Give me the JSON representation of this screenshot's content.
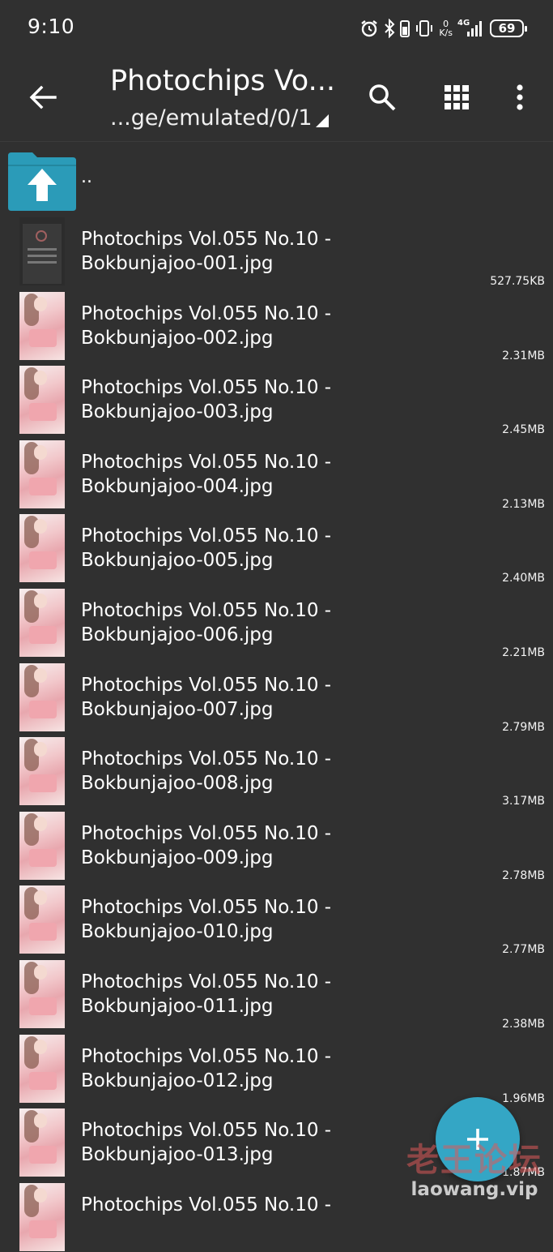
{
  "status_bar": {
    "time": "9:10",
    "net_speed_value": "0",
    "net_speed_unit": "K/s",
    "network": "4G",
    "battery": "69"
  },
  "app_bar": {
    "title": "Photochips Vo...",
    "path": "...ge/emulated/0/1",
    "icons": [
      "back-arrow-icon",
      "search-icon",
      "grid-view-icon",
      "more-vert-icon"
    ]
  },
  "up_entry": {
    "label": ".."
  },
  "files": [
    {
      "line1": "Photochips Vol.055 No.10 -",
      "line2": "Bokbunjajoo-001.jpg",
      "size": "527.75KB"
    },
    {
      "line1": "Photochips Vol.055 No.10 -",
      "line2": "Bokbunjajoo-002.jpg",
      "size": "2.31MB"
    },
    {
      "line1": "Photochips Vol.055 No.10 -",
      "line2": "Bokbunjajoo-003.jpg",
      "size": "2.45MB"
    },
    {
      "line1": "Photochips Vol.055 No.10 -",
      "line2": "Bokbunjajoo-004.jpg",
      "size": "2.13MB"
    },
    {
      "line1": "Photochips Vol.055 No.10 -",
      "line2": "Bokbunjajoo-005.jpg",
      "size": "2.40MB"
    },
    {
      "line1": "Photochips Vol.055 No.10 -",
      "line2": "Bokbunjajoo-006.jpg",
      "size": "2.21MB"
    },
    {
      "line1": "Photochips Vol.055 No.10 -",
      "line2": "Bokbunjajoo-007.jpg",
      "size": "2.79MB"
    },
    {
      "line1": "Photochips Vol.055 No.10 -",
      "line2": "Bokbunjajoo-008.jpg",
      "size": "3.17MB"
    },
    {
      "line1": "Photochips Vol.055 No.10 -",
      "line2": "Bokbunjajoo-009.jpg",
      "size": "2.78MB"
    },
    {
      "line1": "Photochips Vol.055 No.10 -",
      "line2": "Bokbunjajoo-010.jpg",
      "size": "2.77MB"
    },
    {
      "line1": "Photochips Vol.055 No.10 -",
      "line2": "Bokbunjajoo-011.jpg",
      "size": "2.38MB"
    },
    {
      "line1": "Photochips Vol.055 No.10 -",
      "line2": "Bokbunjajoo-012.jpg",
      "size": "1.96MB"
    },
    {
      "line1": "Photochips Vol.055 No.10 -",
      "line2": "Bokbunjajoo-013.jpg",
      "size": "1.87MB"
    },
    {
      "line1": "Photochips Vol.055 No.10 -",
      "line2": "",
      "size": ""
    }
  ],
  "fab": {
    "icon": "plus-icon"
  },
  "watermark": {
    "cn": "老王论坛",
    "url": "laowang.vip"
  },
  "colors": {
    "background": "#303030",
    "accent": "#34a6c5",
    "folder": "#2b9bb8",
    "text": "#ffffff"
  }
}
